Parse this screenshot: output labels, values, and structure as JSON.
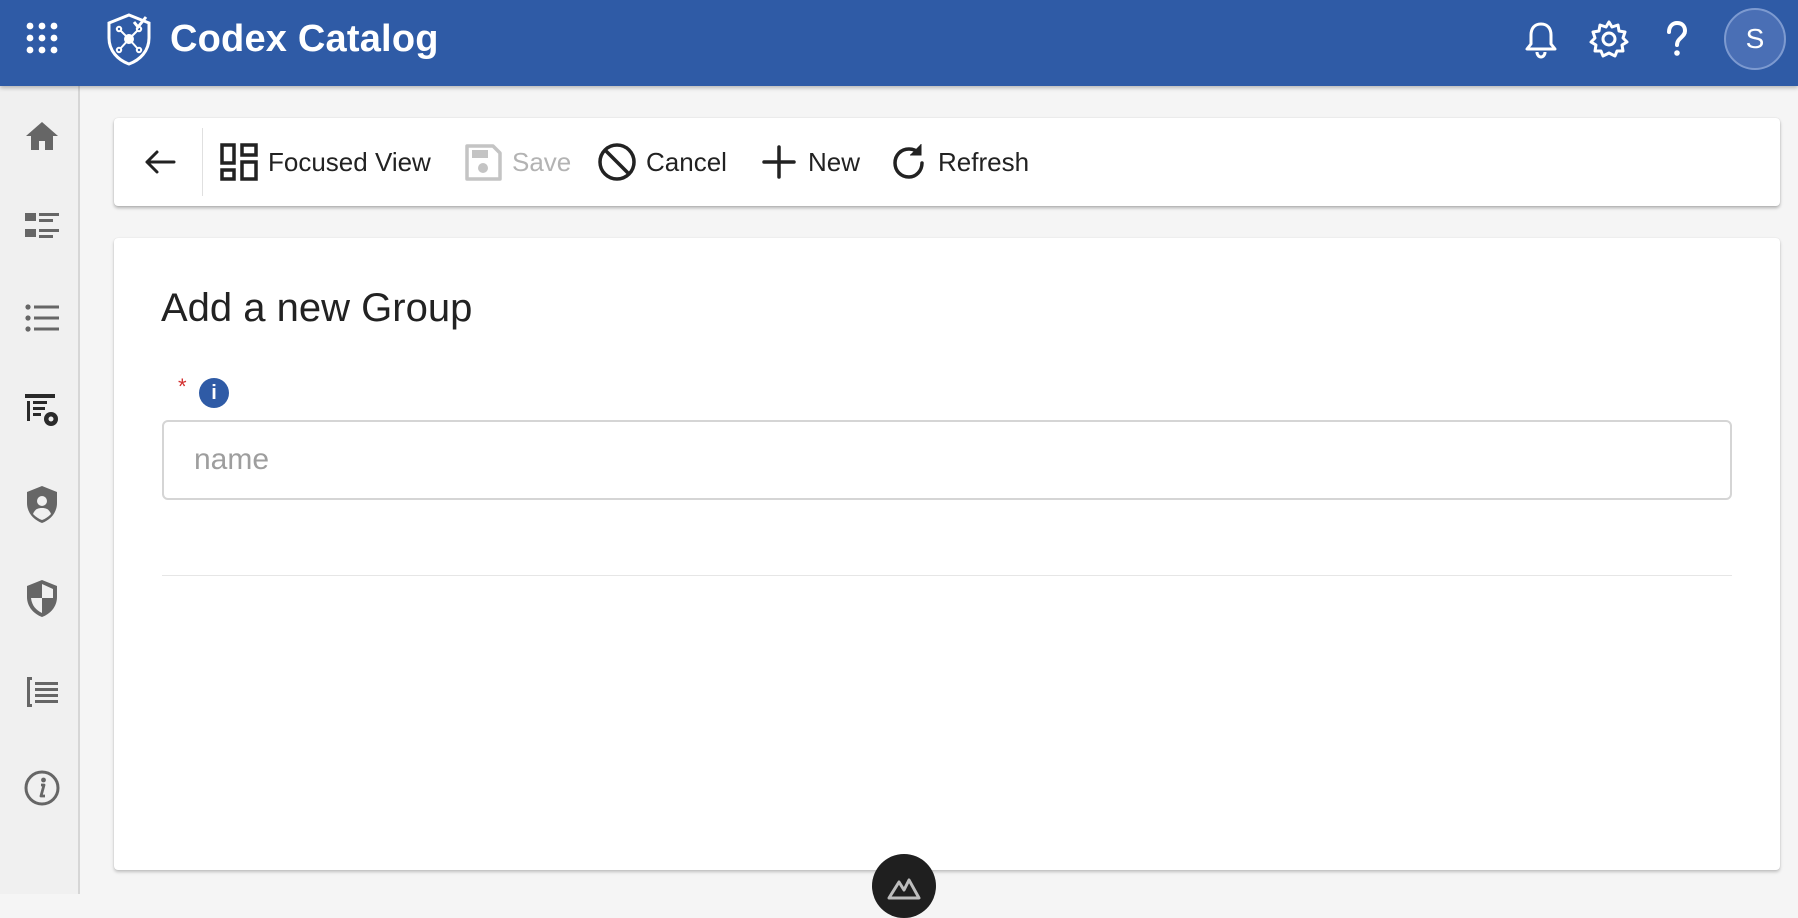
{
  "header": {
    "title": "Codex Catalog",
    "background_color": "#2f5ba6",
    "apps_icon": "apps-grid-icon",
    "logo_icon": "shield-check-logo",
    "actions": [
      {
        "icon": "bell-icon"
      },
      {
        "icon": "gear-icon"
      },
      {
        "icon": "help-icon"
      }
    ],
    "avatar_initial": "S"
  },
  "sidebar": {
    "items": [
      {
        "icon": "home-icon"
      },
      {
        "icon": "dashboard-list-icon"
      },
      {
        "icon": "list-icon"
      },
      {
        "icon": "table-settings-icon"
      },
      {
        "icon": "user-shield-icon"
      },
      {
        "icon": "shield-half-icon"
      },
      {
        "icon": "bracket-list-icon"
      },
      {
        "icon": "info-circle-icon"
      }
    ]
  },
  "toolbar": {
    "back_icon": "arrow-left-icon",
    "focused_view_label": "Focused View",
    "save_label": "Save",
    "cancel_label": "Cancel",
    "new_label": "New",
    "refresh_label": "Refresh"
  },
  "form": {
    "title": "Add a new Group",
    "required_marker": "*",
    "info_icon_glyph": "i",
    "name_placeholder": "name",
    "name_value": ""
  },
  "fab": {
    "icon": "mountain-logo-icon"
  }
}
